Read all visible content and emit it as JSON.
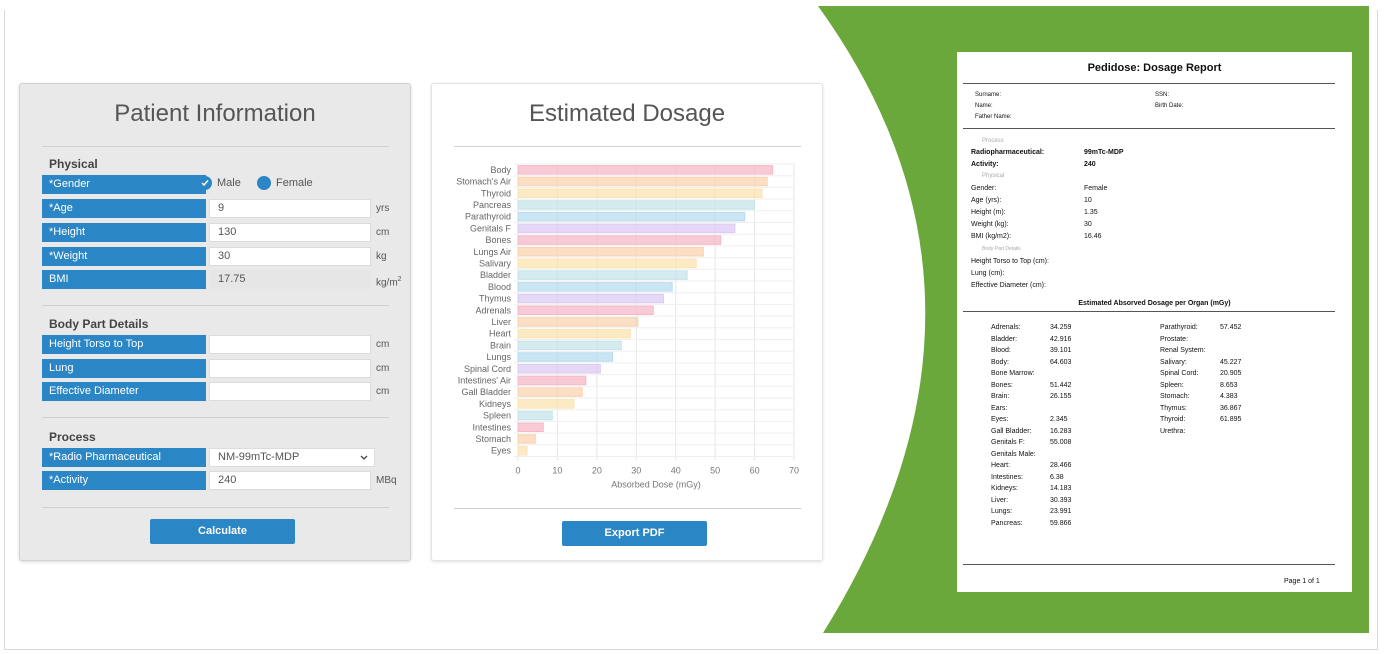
{
  "colors": {
    "accent": "#2b86c5",
    "green": "#6aa83c"
  },
  "patient": {
    "title": "Patient Information",
    "physical_title": "Physical",
    "gender_label": "*Gender",
    "gender_options": [
      "Male",
      "Female"
    ],
    "gender_selected": "Male",
    "age": {
      "label": "*Age",
      "value": "9",
      "unit": "yrs"
    },
    "height": {
      "label": "*Height",
      "value": "130",
      "unit": "cm"
    },
    "weight": {
      "label": "*Weight",
      "value": "30",
      "unit": "kg"
    },
    "bmi": {
      "label": "BMI",
      "value": "17.75",
      "unit": "kg/m",
      "unit_sup": "2"
    },
    "body_title": "Body Part Details",
    "torso": {
      "label": "Height Torso to Top",
      "value": "",
      "unit": "cm"
    },
    "lung": {
      "label": "Lung",
      "value": "",
      "unit": "cm"
    },
    "diameter": {
      "label": "Effective Diameter",
      "value": "",
      "unit": "cm"
    },
    "process_title": "Process",
    "radio": {
      "label": "*Radio Pharmaceutical",
      "value": "NM-99mTc-MDP"
    },
    "activity": {
      "label": "*Activity",
      "value": "240",
      "unit": "MBq"
    },
    "calculate_label": "Calculate"
  },
  "dosage": {
    "title": "Estimated Dosage",
    "export_label": "Export PDF"
  },
  "chart_data": {
    "type": "bar",
    "orientation": "horizontal",
    "categories": [
      "Body",
      "Stomach's Air",
      "Thyroid",
      "Pancreas",
      "Parathyroid",
      "Genitals F",
      "Bones",
      "Lungs Air",
      "Salivary",
      "Bladder",
      "Blood",
      "Thymus",
      "Adrenals",
      "Liver",
      "Heart",
      "Brain",
      "Lungs",
      "Spinal Cord",
      "Intestines' Air",
      "Gall Bladder",
      "Kidneys",
      "Spleen",
      "Intestines",
      "Stomach",
      "Eyes"
    ],
    "values": [
      64.6,
      63.2,
      61.9,
      59.9,
      57.5,
      55.0,
      51.4,
      47.0,
      45.2,
      42.9,
      39.1,
      36.9,
      34.3,
      30.4,
      28.5,
      26.2,
      24.0,
      20.9,
      17.2,
      16.3,
      14.2,
      8.7,
      6.4,
      4.4,
      2.3
    ],
    "colors": [
      "#f5b8c8",
      "#fad3b0",
      "#fbe3b2",
      "#c6e4ea",
      "#b8dcef",
      "#dccbf3",
      "#f5b8c8",
      "#fad3b0",
      "#fbe3b2",
      "#c6e4ea",
      "#b8dcef",
      "#dccbf3",
      "#f5b8c8",
      "#fad3b0",
      "#fbe3b2",
      "#c6e4ea",
      "#b8dcef",
      "#dccbf3",
      "#f5b8c8",
      "#fad3b0",
      "#fbe3b2",
      "#c6e4ea",
      "#f5b8c8",
      "#fad3b0",
      "#fbe3b2"
    ],
    "xlabel": "Absorbed Dose (mGy)",
    "ylabel": "",
    "xlim": [
      0,
      70
    ],
    "xticks": [
      0,
      10,
      20,
      30,
      40,
      50,
      60,
      70
    ],
    "grid": true
  },
  "report": {
    "title": "Pedidose: Dosage Report",
    "surname": "Surname:",
    "ssn": "SSN:",
    "name": "Name:",
    "birth": "Birth Date:",
    "father": "Father Name:",
    "process_head": "Process",
    "radiopharm_label": "Radiopharmaceutical:",
    "radiopharm_value": "99mTc-MDP",
    "activity_label": "Activity:",
    "activity_value": "240",
    "physical_head": "Physical",
    "gender_label": "Gender:",
    "gender_value": "Female",
    "age_label": "Age (yrs):",
    "age_value": "10",
    "height_label": "Height (m):",
    "height_value": "1.35",
    "weight_label": "Weight (kg):",
    "weight_value": "30",
    "bmi_label": "BMI (kg/m2):",
    "bmi_value": "16.46",
    "body_head": "Body Part Details",
    "torso_label": "Height Torso to Top (cm):",
    "lung_label": "Lung (cm):",
    "diam_label": "Effective Diameter (cm):",
    "organ_head": "Estimated Absorved Dosage per Organ (mGy)",
    "col1": [
      {
        "o": "Adrenals:",
        "v": "34.259"
      },
      {
        "o": "Bladder:",
        "v": "42.916"
      },
      {
        "o": "Blood:",
        "v": "39.101"
      },
      {
        "o": "Body:",
        "v": "64.603"
      },
      {
        "o": "Bone Marrow:",
        "v": ""
      },
      {
        "o": "Bones:",
        "v": "51.442"
      },
      {
        "o": "Brain:",
        "v": "26.155"
      },
      {
        "o": "Ears:",
        "v": ""
      },
      {
        "o": "Eyes:",
        "v": "2.345"
      },
      {
        "o": "Gall Bladder:",
        "v": "16.283"
      },
      {
        "o": "Genitals F:",
        "v": "55.008"
      },
      {
        "o": "Genitals Male:",
        "v": ""
      },
      {
        "o": "Heart:",
        "v": "28.466"
      },
      {
        "o": "Intestines:",
        "v": "6.38"
      },
      {
        "o": "Kidneys:",
        "v": "14.183"
      },
      {
        "o": "Liver:",
        "v": "30.393"
      },
      {
        "o": "Lungs:",
        "v": "23.991"
      },
      {
        "o": "Pancreas:",
        "v": "59.866"
      }
    ],
    "col2": [
      {
        "o": "Parathyroid:",
        "v": "57.452"
      },
      {
        "o": "Prostate:",
        "v": ""
      },
      {
        "o": "Renal System:",
        "v": ""
      },
      {
        "o": "Salivary:",
        "v": "45.227"
      },
      {
        "o": "Spinal Cord:",
        "v": "20.905"
      },
      {
        "o": "Spleen:",
        "v": "8.653"
      },
      {
        "o": "Stomach:",
        "v": "4.383"
      },
      {
        "o": "Thymus:",
        "v": "36.867"
      },
      {
        "o": "Thyroid:",
        "v": "61.895"
      },
      {
        "o": "Urethra:",
        "v": ""
      }
    ],
    "page": "Page 1 of 1"
  }
}
